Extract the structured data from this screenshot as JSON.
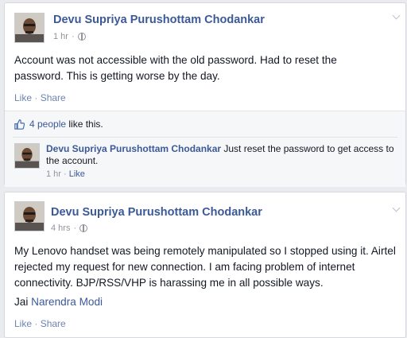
{
  "posts": [
    {
      "author": "Devu Supriya Purushottam Chodankar",
      "time": "1 hr",
      "text": "Account was not accessible with the old password. Had to reset the password. This is getting worse by the day.",
      "actions": {
        "like": "Like",
        "sep": " · ",
        "share": "Share"
      },
      "likes": {
        "count_text": "4 people",
        "suffix": " like this."
      },
      "comment": {
        "author": "Devu Supriya Purushottam Chodankar",
        "text": " Just reset the password to get access to the account.",
        "time": "1 hr",
        "sep": " · ",
        "like": "Like"
      }
    },
    {
      "author": "Devu Supriya Purushottam Chodankar",
      "time": "4 hrs",
      "text": "My Lenovo handset was being remotely manipulated so I stopped using it. Airtel rejected my request for new connection. I am facing problem of internet connectivity. BJP/RSS/VHP is harassing me in all possible ways.",
      "closing_prefix": "Jai ",
      "closing_mention": "Narendra Modi",
      "actions": {
        "like": "Like",
        "sep": " · ",
        "share": "Share"
      }
    }
  ],
  "icons": {
    "privacy": "globe-icon",
    "menu": "chevron-down-icon",
    "like": "thumbs-up-icon"
  },
  "colors": {
    "link": "#3b5998",
    "muted": "#90949c",
    "background": "#e9ebee"
  }
}
